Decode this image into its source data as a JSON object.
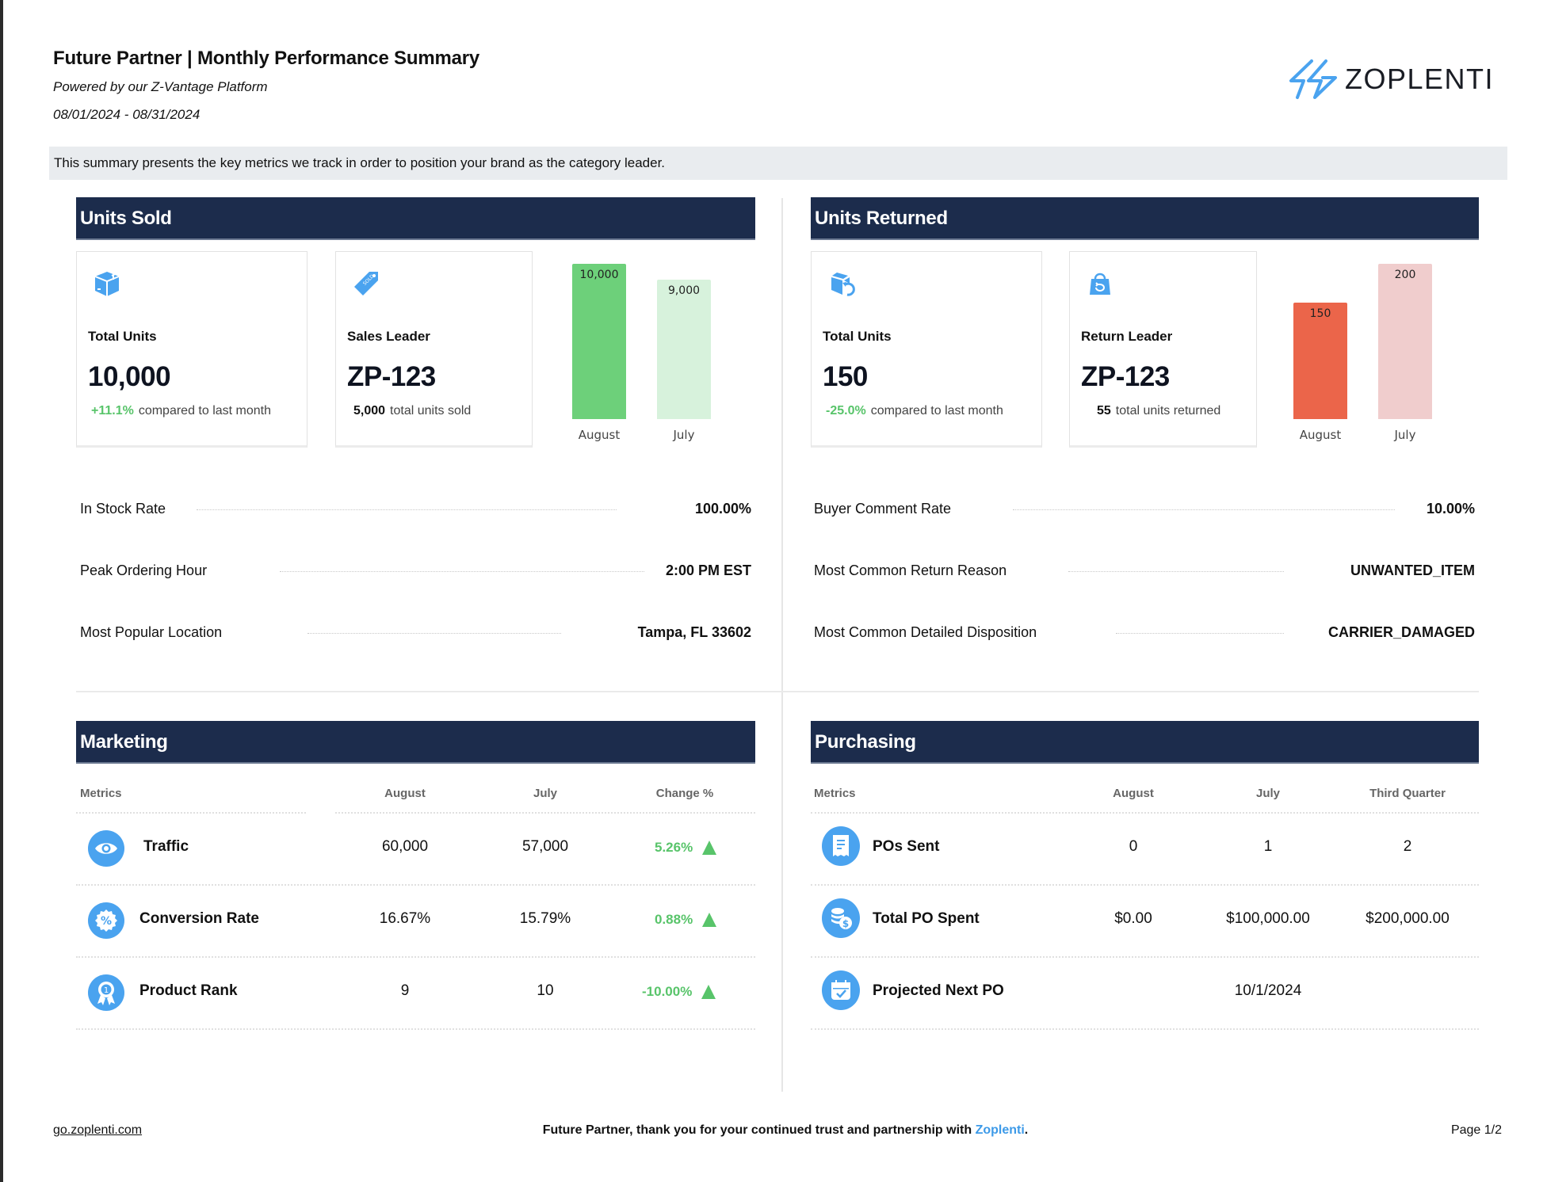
{
  "header": {
    "title": "Future Partner | Monthly Performance Summary",
    "subtitle": "Powered by our Z-Vantage Platform",
    "date_range": "08/01/2024 - 08/31/2024",
    "logo_text": "ZOPLENTI"
  },
  "banner": "This summary presents the key metrics we track in order to position your brand as the category leader.",
  "units_sold": {
    "title": "Units Sold",
    "card_total": {
      "icon": "box-icon",
      "label": "Total Units",
      "value": "10,000",
      "change": "+11.1%",
      "change_text": "compared to last month"
    },
    "card_leader": {
      "icon": "sold-out-tag-icon",
      "label": "Sales Leader",
      "value": "ZP-123",
      "sub_value": "5,000",
      "sub_text": "total units sold"
    },
    "kv": [
      {
        "label": "In Stock Rate",
        "value": "100.00%"
      },
      {
        "label": "Peak Ordering Hour",
        "value": "2:00 PM EST"
      },
      {
        "label": "Most Popular Location",
        "value": "Tampa, FL 33602"
      }
    ]
  },
  "units_returned": {
    "title": "Units Returned",
    "card_total": {
      "icon": "return-box-icon",
      "label": "Total Units",
      "value": "150",
      "change": "-25.0%",
      "change_text": "compared to last month"
    },
    "card_leader": {
      "icon": "return-bag-icon",
      "label": "Return Leader",
      "value": "ZP-123",
      "sub_value": "55",
      "sub_text": "total units returned"
    },
    "kv": [
      {
        "label": "Buyer Comment Rate",
        "value": "10.00%"
      },
      {
        "label": "Most Common Return Reason",
        "value": "UNWANTED_ITEM"
      },
      {
        "label": "Most Common Detailed Disposition",
        "value": "CARRIER_DAMAGED"
      }
    ]
  },
  "marketing": {
    "title": "Marketing",
    "columns": [
      "Metrics",
      "August",
      "July",
      "Change %"
    ],
    "rows": [
      {
        "icon": "eye-icon",
        "name": "Traffic",
        "august": "60,000",
        "july": "57,000",
        "change": "5.26%",
        "trend": "up"
      },
      {
        "icon": "percent-badge-icon",
        "name": "Conversion Rate",
        "august": "16.67%",
        "july": "15.79%",
        "change": "0.88%",
        "trend": "up"
      },
      {
        "icon": "award-ribbon-icon",
        "name": "Product Rank",
        "august": "9",
        "july": "10",
        "change": "-10.00%",
        "trend": "up"
      }
    ]
  },
  "purchasing": {
    "title": "Purchasing",
    "columns": [
      "Metrics",
      "August",
      "July",
      "Third Quarter"
    ],
    "rows": [
      {
        "icon": "receipt-icon",
        "name": "POs Sent",
        "august": "0",
        "july": "1",
        "quarter": "2"
      },
      {
        "icon": "coins-dollar-icon",
        "name": "Total PO Spent",
        "august": "$0.00",
        "july": "$100,000.00",
        "quarter": "$200,000.00"
      },
      {
        "icon": "calendar-check-icon",
        "name": "Projected Next PO",
        "august": "",
        "july": "10/1/2024",
        "quarter": ""
      }
    ]
  },
  "footer": {
    "link": "go.zoplenti.com",
    "message": "Future Partner,  thank you for your continued trust and partnership with ",
    "brand": "Zoplenti",
    "period": ".",
    "page": "Page 1/2"
  },
  "colors": {
    "navy_header": "#1c2c4c",
    "accent_blue": "#4aa3ef",
    "positive_green": "#58c46a",
    "sold_current": "#6dd07a",
    "sold_previous": "#d7f2dc",
    "returned_current": "#eb654a",
    "returned_previous": "#f0cdcd"
  },
  "chart_data": [
    {
      "type": "bar",
      "title": "Units Sold",
      "categories": [
        "August",
        "July"
      ],
      "values": [
        10000,
        9000
      ],
      "data_labels": [
        "10,000",
        "9,000"
      ],
      "colors": [
        "#6dd07a",
        "#d7f2dc"
      ],
      "ylim": [
        0,
        10000
      ],
      "grid": false,
      "xlabel": "",
      "ylabel": ""
    },
    {
      "type": "bar",
      "title": "Units Returned",
      "categories": [
        "August",
        "July"
      ],
      "values": [
        150,
        200
      ],
      "data_labels": [
        "150",
        "200"
      ],
      "colors": [
        "#eb654a",
        "#f0cdcd"
      ],
      "ylim": [
        0,
        200
      ],
      "grid": false,
      "xlabel": "",
      "ylabel": ""
    }
  ]
}
